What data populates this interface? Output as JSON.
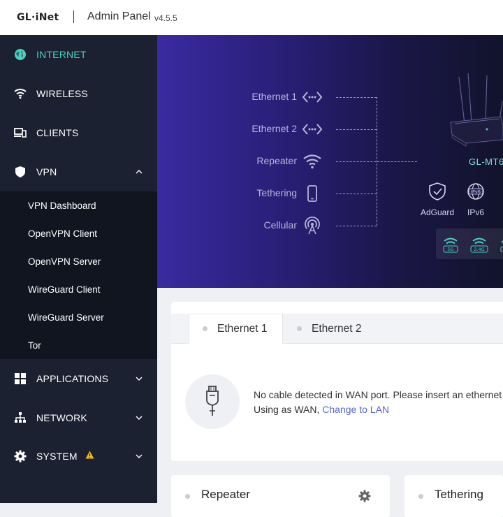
{
  "header": {
    "logo": "GL·iNet",
    "title": "Admin Panel",
    "version": "v4.5.5"
  },
  "sidebar": {
    "items": [
      {
        "label": "INTERNET",
        "icon": "globe-icon",
        "active": true
      },
      {
        "label": "WIRELESS",
        "icon": "wifi-icon"
      },
      {
        "label": "CLIENTS",
        "icon": "devices-icon"
      },
      {
        "label": "VPN",
        "icon": "shield-icon",
        "expanded": true
      },
      {
        "label": "APPLICATIONS",
        "icon": "apps-grid-icon"
      },
      {
        "label": "NETWORK",
        "icon": "network-icon"
      },
      {
        "label": "SYSTEM",
        "icon": "gear-icon",
        "warning": true
      }
    ],
    "vpn_submenu": [
      "VPN Dashboard",
      "OpenVPN Client",
      "OpenVPN Server",
      "WireGuard Client",
      "WireGuard Server",
      "Tor"
    ]
  },
  "hero": {
    "connections": [
      {
        "label": "Ethernet 1",
        "icon": "ethernet-icon"
      },
      {
        "label": "Ethernet 2",
        "icon": "ethernet-icon"
      },
      {
        "label": "Repeater",
        "icon": "wifi-icon"
      },
      {
        "label": "Tethering",
        "icon": "phone-icon"
      },
      {
        "label": "Cellular",
        "icon": "cellular-antenna-icon"
      }
    ],
    "router_name": "GL-MT6",
    "features": [
      {
        "label": "AdGuard",
        "icon": "adguard-shield-icon"
      },
      {
        "label": "IPv6",
        "icon": "ipv6-globe-icon"
      }
    ],
    "wifi_bands": [
      "5G",
      "2.4G"
    ]
  },
  "main_card": {
    "tabs": [
      "Ethernet 1",
      "Ethernet 2"
    ],
    "active_tab": "Ethernet 1",
    "message_line1": "No cable detected in WAN port. Please insert an ethernet",
    "message_line2_prefix": "Using as WAN,",
    "message_link": "Change to LAN"
  },
  "bottom_cards": [
    "Repeater",
    "Tethering"
  ],
  "colors": {
    "accent": "#49d1c1",
    "link": "#5a63d6",
    "sidebar_bg": "#1b2130",
    "warning": "#f2b81f"
  }
}
